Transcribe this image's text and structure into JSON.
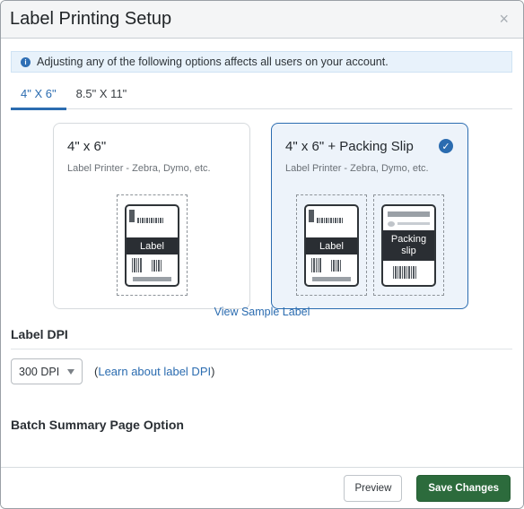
{
  "modal": {
    "title": "Label Printing Setup",
    "close_label": "×"
  },
  "notice": {
    "icon": "info-icon",
    "text": "Adjusting any of the following options affects all users on your account."
  },
  "tabs": [
    {
      "label": "4\" X 6\"",
      "active": true
    },
    {
      "label": "8.5\" X 11\"",
      "active": false
    }
  ],
  "cards": [
    {
      "title": "4\" x 6\"",
      "subtitle": "Label Printer - Zebra, Dymo, etc.",
      "selected": false,
      "label_text": "Label"
    },
    {
      "title": "4\" x 6\" + Packing Slip",
      "subtitle": "Label Printer - Zebra, Dymo, etc.",
      "selected": true,
      "label_text": "Label",
      "slip_text": "Packing slip"
    }
  ],
  "view_sample": "View Sample Label",
  "label_dpi": {
    "title": "Label DPI",
    "selected": "300 DPI",
    "learn_prefix": "(",
    "learn_link": "Learn about label DPI",
    "learn_suffix": ")"
  },
  "batch_summary": {
    "title": "Batch Summary Page Option"
  },
  "footer": {
    "preview_label": "Preview",
    "save_label": "Save Changes"
  },
  "colors": {
    "accent": "#2b6cb0",
    "primary_button": "#2c6b3c",
    "notice_bg": "#e8f2fb",
    "selected_card_bg": "#edf3fa"
  }
}
